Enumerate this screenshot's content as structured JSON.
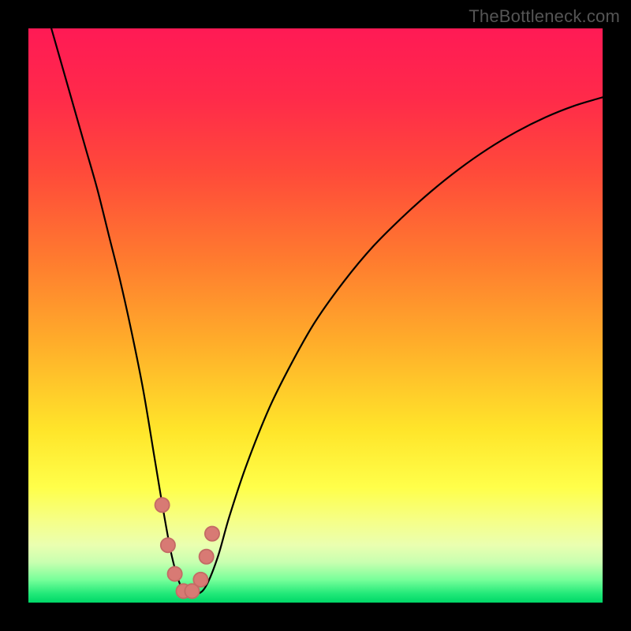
{
  "watermark": {
    "text": "TheBottleneck.com"
  },
  "colors": {
    "frame": "#000000",
    "curve_stroke": "#000000",
    "marker_fill": "#d87a74",
    "marker_stroke": "#c46b65",
    "gradient_stops": [
      {
        "offset": 0.0,
        "color": "#ff1a55"
      },
      {
        "offset": 0.12,
        "color": "#ff2a4a"
      },
      {
        "offset": 0.25,
        "color": "#ff4a3a"
      },
      {
        "offset": 0.4,
        "color": "#ff7a2f"
      },
      {
        "offset": 0.55,
        "color": "#ffae2a"
      },
      {
        "offset": 0.7,
        "color": "#ffe52a"
      },
      {
        "offset": 0.8,
        "color": "#ffff4a"
      },
      {
        "offset": 0.86,
        "color": "#f5ff8a"
      },
      {
        "offset": 0.9,
        "color": "#eaffb0"
      },
      {
        "offset": 0.93,
        "color": "#c8ffb0"
      },
      {
        "offset": 0.96,
        "color": "#78ff9a"
      },
      {
        "offset": 0.985,
        "color": "#20e878"
      },
      {
        "offset": 1.0,
        "color": "#00d868"
      }
    ]
  },
  "chart_data": {
    "type": "line",
    "title": "",
    "xlabel": "",
    "ylabel": "",
    "xlim": [
      0,
      100
    ],
    "ylim": [
      0,
      100
    ],
    "series": [
      {
        "name": "bottleneck-curve",
        "x": [
          4,
          6,
          8,
          10,
          12,
          14,
          16,
          18,
          20,
          22,
          23.5,
          25,
          26.5,
          28,
          29.5,
          31,
          33,
          35,
          38,
          42,
          46,
          50,
          55,
          60,
          65,
          70,
          75,
          80,
          85,
          90,
          95,
          100
        ],
        "y": [
          100,
          93,
          86,
          79,
          72,
          64,
          56,
          47,
          37,
          25,
          16,
          8,
          3,
          1.5,
          1.5,
          3,
          8,
          15,
          24,
          34,
          42,
          49,
          56,
          62,
          67,
          71.5,
          75.5,
          79,
          82,
          84.5,
          86.5,
          88
        ]
      }
    ],
    "markers": {
      "name": "highlight-dots",
      "x": [
        23.3,
        24.3,
        25.5,
        27.0,
        28.5,
        30.0,
        31.0,
        32.0
      ],
      "y": [
        17,
        10,
        5,
        2,
        2,
        4,
        8,
        12
      ]
    }
  }
}
